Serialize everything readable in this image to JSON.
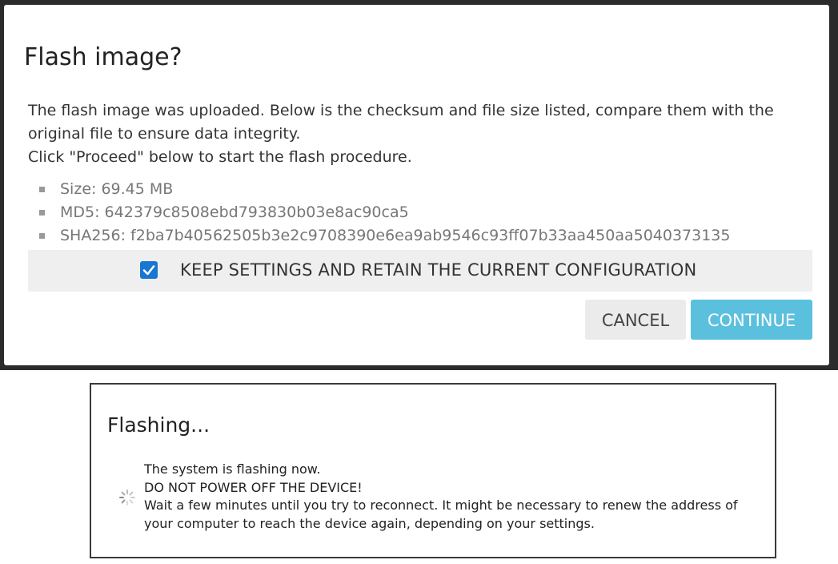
{
  "flash_dialog": {
    "title": "Flash image?",
    "description_line1": "The flash image was uploaded. Below is the checksum and file size listed, compare them with the original file to ensure data integrity.",
    "description_line2": "Click \"Proceed\" below to start the flash procedure.",
    "details": [
      "Size: 69.45 MB",
      "MD5: 642379c8508ebd793830b03e8ac90ca5",
      "SHA256: f2ba7b40562505b3e2c9708390e6ea9ab9546c93ff07b33aa450aa5040373135"
    ],
    "keep_settings": {
      "label": "KEEP SETTINGS AND RETAIN THE CURRENT CONFIGURATION",
      "checked": true
    },
    "cancel_label": "CANCEL",
    "continue_label": "CONTINUE",
    "colors": {
      "checkbox": "#1976d2",
      "continue_button": "#5bc0de",
      "cancel_button": "#ebebeb"
    }
  },
  "flashing_dialog": {
    "title": "Flashing...",
    "line1": "The system is flashing now.",
    "line2": "DO NOT POWER OFF THE DEVICE!",
    "line3": "Wait a few minutes until you try to reconnect. It might be necessary to renew the address of your computer to reach the device again, depending on your settings.",
    "icon": "spinner-icon"
  }
}
